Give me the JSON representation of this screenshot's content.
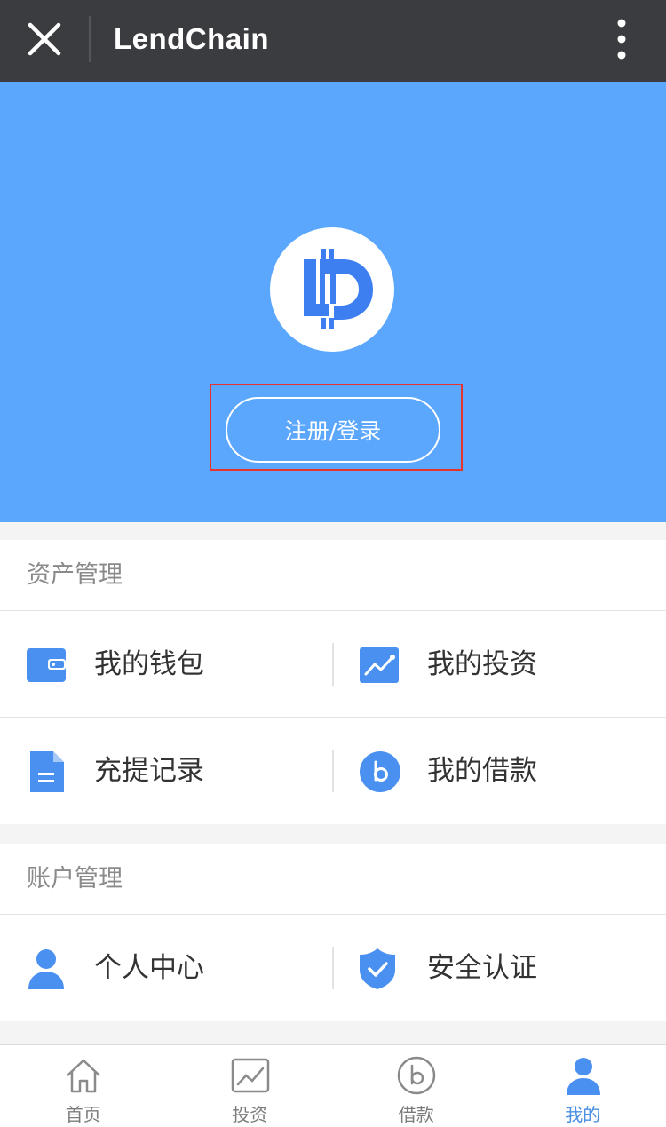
{
  "titlebar": {
    "title": "LendChain",
    "close_icon": "close-icon",
    "more_icon": "more-vertical-icon"
  },
  "hero": {
    "logo": "lendchain-logo",
    "login_label": "注册/登录"
  },
  "asset_section": {
    "header": "资产管理",
    "items": [
      {
        "label": "我的钱包",
        "icon": "wallet-icon"
      },
      {
        "label": "我的投资",
        "icon": "investment-chart-icon"
      },
      {
        "label": "充提记录",
        "icon": "document-icon"
      },
      {
        "label": "我的借款",
        "icon": "loan-b-icon"
      }
    ]
  },
  "account_section": {
    "header": "账户管理",
    "items": [
      {
        "label": "个人中心",
        "icon": "person-icon"
      },
      {
        "label": "安全认证",
        "icon": "shield-check-icon"
      }
    ]
  },
  "tabbar": {
    "tabs": [
      {
        "label": "首页",
        "icon": "home-icon"
      },
      {
        "label": "投资",
        "icon": "chart-icon"
      },
      {
        "label": "借款",
        "icon": "loan-b-icon"
      },
      {
        "label": "我的",
        "icon": "user-icon",
        "active": true
      }
    ]
  },
  "colors": {
    "accent": "#5ba7fe",
    "icon_blue": "#4a90f0",
    "title_bar": "#3b3c40",
    "highlight": "#e8322f"
  }
}
